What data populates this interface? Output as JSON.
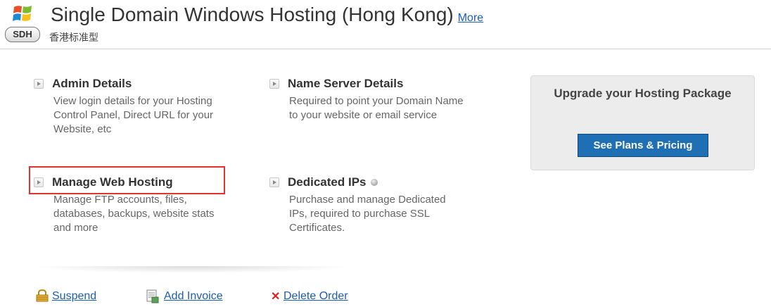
{
  "header": {
    "logo_badge": "SDH",
    "title": "Single Domain Windows Hosting (Hong Kong)",
    "more_link": "More",
    "subtitle": "香港标准型"
  },
  "sections": [
    {
      "title": "Admin Details",
      "description": "View login details for your Hosting Control Panel, Direct URL for your Website, etc"
    },
    {
      "title": "Name Server Details",
      "description": "Required to point your Domain Name to your website or email service"
    },
    {
      "title": "Manage Web Hosting",
      "description": "Manage FTP accounts, files, databases, backups, website stats and more"
    },
    {
      "title": "Dedicated IPs",
      "description": "Purchase and manage Dedicated IPs, required to purchase SSL Certificates."
    }
  ],
  "upgrade": {
    "title": "Upgrade your Hosting Package",
    "button_label": "See Plans & Pricing"
  },
  "actions": {
    "suspend": "Suspend",
    "add_invoice": "Add Invoice",
    "delete_order": "Delete Order"
  },
  "colors": {
    "link": "#1a5fb4",
    "highlight": "#e23333",
    "button": "#1e6fb3",
    "delete_x": "#e02020"
  }
}
